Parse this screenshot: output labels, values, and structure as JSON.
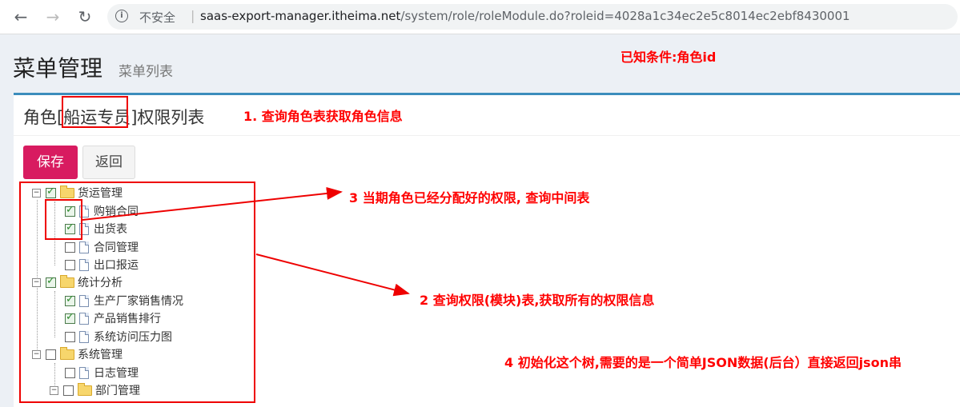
{
  "browser": {
    "insecure_label": "不安全",
    "separator": "|",
    "url_host": "saas-export-manager.itheima.net",
    "url_path": "/system/role/roleModule.do?roleid=4028a1c34ec2e5c8014ec2ebf8430001"
  },
  "header": {
    "title": "菜单管理",
    "subtitle": "菜单列表"
  },
  "box": {
    "title_prefix": "角色",
    "title_role": "[船运专员]",
    "title_suffix": "权限列表"
  },
  "buttons": {
    "save": "保存",
    "back": "返回"
  },
  "tree": {
    "n1": "货运管理",
    "n1_1": "购销合同",
    "n1_2": "出货表",
    "n1_3": "合同管理",
    "n1_4": "出口报运",
    "n2": "统计分析",
    "n2_1": "生产厂家销售情况",
    "n2_2": "产品销售排行",
    "n2_3": "系统访问压力图",
    "n3": "系统管理",
    "n3_1": "日志管理",
    "n3_2": "部门管理"
  },
  "annotations": {
    "known": "已知条件:角色id",
    "step1": "1. 查询角色表获取角色信息",
    "step3": "3 当期角色已经分配好的权限, 查询中间表",
    "step2": "2 查询权限(模块)表,获取所有的权限信息",
    "step4": "4 初始化这个树,需要的是一个简单JSON数据(后台）直接返回json串"
  },
  "colors": {
    "accent": "#3c8dbc",
    "save_button": "#d81b60",
    "annotation": "#ff0000"
  }
}
